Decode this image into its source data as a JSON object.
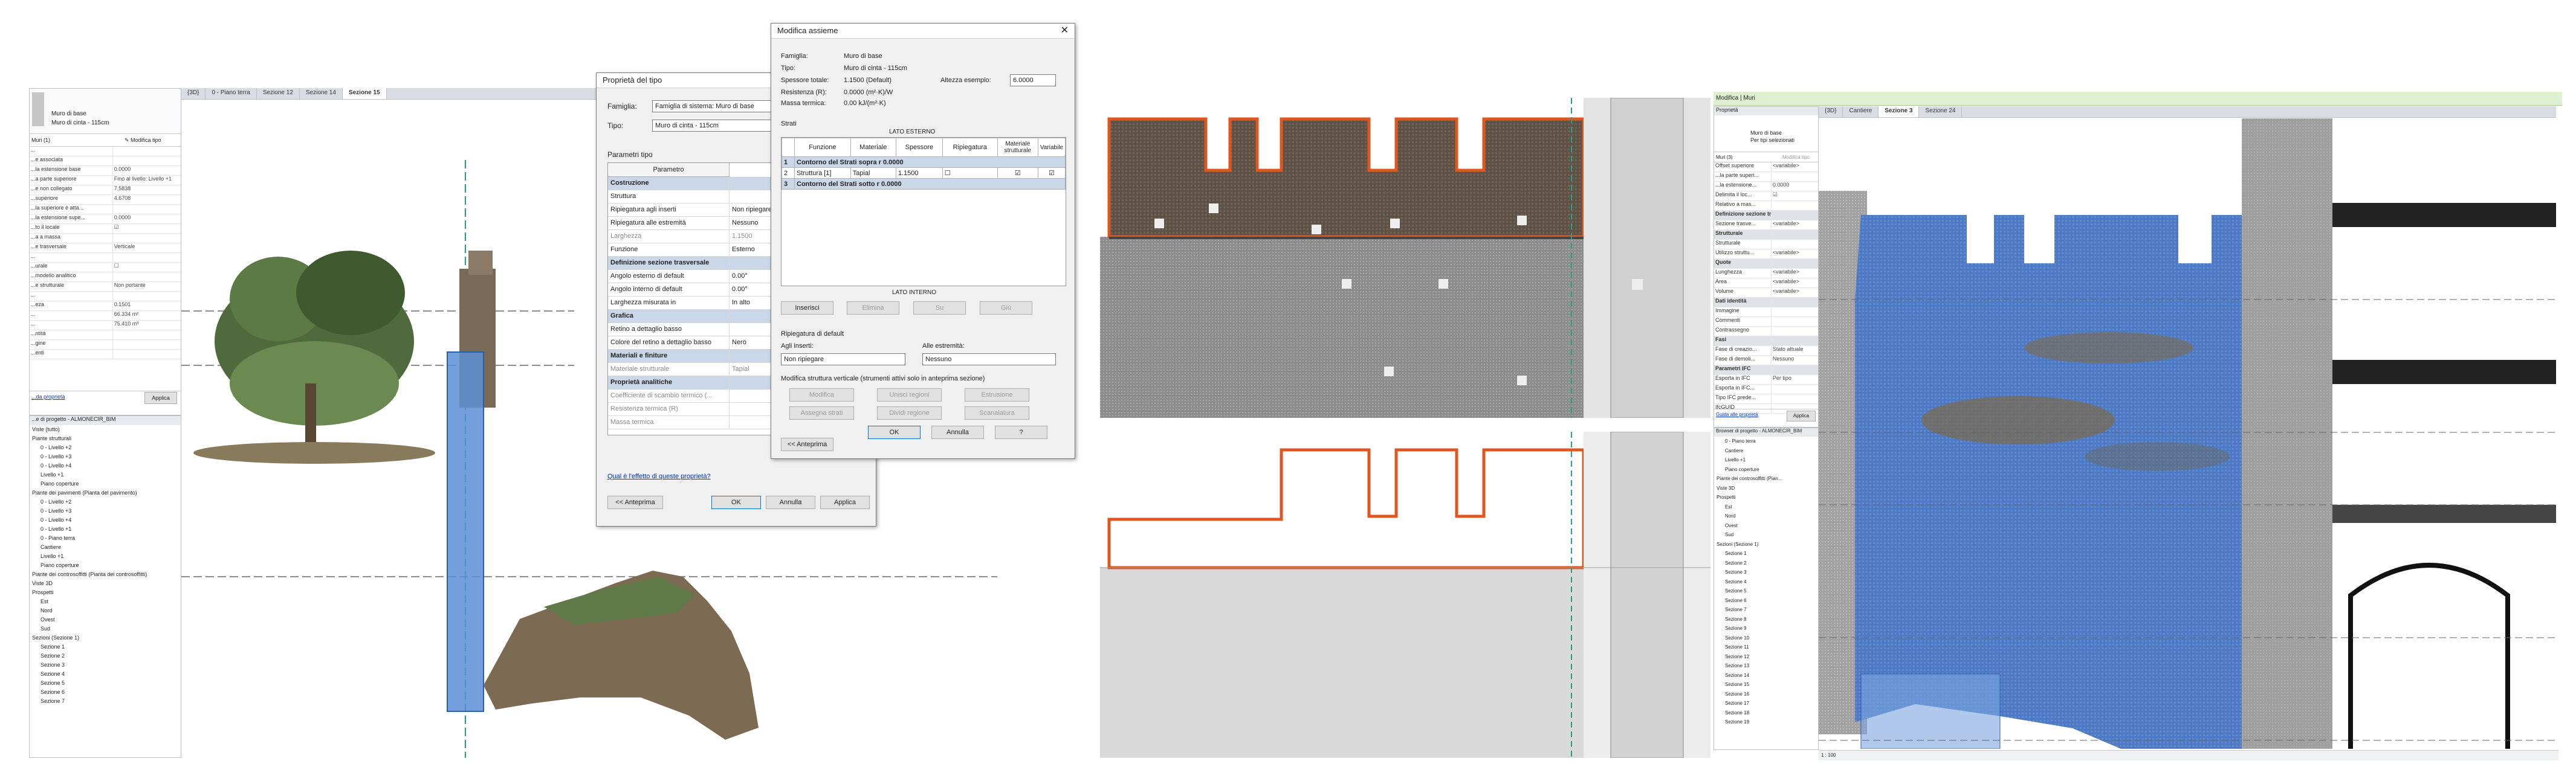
{
  "panel1": {
    "view_tabs": [
      "{3D}",
      "0 - Piano terra",
      "Sezione 12",
      "Sezione 14",
      "Sezione 15"
    ],
    "properties": {
      "type_line1": "Muro di base",
      "type_line2": "Muro di cinta - 115cm",
      "filter_label": "Muri (1)",
      "edit_type_label": "Modifica tipo",
      "rows": [
        {
          "k": "...",
          "v": ""
        },
        {
          "k": "...e associata",
          "v": ""
        },
        {
          "k": "...la estensione base",
          "v": "0.0000"
        },
        {
          "k": "...a parte superiore",
          "v": "Fino al livello: Livello +1"
        },
        {
          "k": "...e non collegato",
          "v": "7.5838"
        },
        {
          "k": "...superiore",
          "v": "4.6708"
        },
        {
          "k": "...la superiore è atta...",
          "v": ""
        },
        {
          "k": "...la estensione supe...",
          "v": "0.0000"
        },
        {
          "k": "...to il locale",
          "v": "☑"
        },
        {
          "k": "...a a massa",
          "v": ""
        },
        {
          "k": "...e trasversale",
          "v": "Verticale"
        },
        {
          "k": "...",
          "v": ""
        },
        {
          "k": "...urale",
          "v": "☐"
        },
        {
          "k": "...modello analitico",
          "v": ""
        },
        {
          "k": "...e strutturale",
          "v": "Non portante"
        },
        {
          "k": "...",
          "v": ""
        },
        {
          "k": "...eza",
          "v": "0.1501"
        },
        {
          "k": "...",
          "v": "66.334 m²"
        },
        {
          "k": "...",
          "v": "75.410 m³"
        },
        {
          "k": "...ntità",
          "v": ""
        },
        {
          "k": "...gine",
          "v": ""
        },
        {
          "k": "...enti",
          "v": ""
        }
      ],
      "help_link": "...da proprietà",
      "apply_label": "Applica"
    },
    "browser_title": "...e di progetto - ALMONECIR_BIM",
    "browser_items": [
      "Viste (tutto)",
      "Piante strutturali",
      "0 - Livello +2",
      "0 - Livello +3",
      "0 - Livello +4",
      "Livello +1",
      "Piano coperture",
      "Piante dei pavimenti (Pianta del pavimento)",
      "0 - Livello +2",
      "0 - Livello +3",
      "0 - Livello +4",
      "0 - Livello +1",
      "0 - Piano terra",
      "Cantiere",
      "Livello +1",
      "Piano coperture",
      "Piante dei controsoffitti (Pianta dei controsoffitti)",
      "Viste 3D",
      "Prospetti",
      "Est",
      "Nord",
      "Ovest",
      "Sud",
      "Sezioni (Sezione 1)",
      "Sezione 1",
      "Sezione 2",
      "Sezione 3",
      "Sezione 4",
      "Sezione 5",
      "Sezione 6",
      "Sezione 7"
    ],
    "dialog": {
      "title": "Proprietà del tipo",
      "family_label": "Famiglia:",
      "family_value": "Famiglia di sistema: Muro di base",
      "type_label": "Tipo:",
      "type_value": "Muro di cinta - 115cm",
      "params_label": "Parametri tipo",
      "col_param": "Parametro",
      "rows": [
        {
          "k": "Costruzione",
          "v": "",
          "cat": true
        },
        {
          "k": "Struttura",
          "v": ""
        },
        {
          "k": "Ripiegatura agli inserti",
          "v": "Non ripiegare"
        },
        {
          "k": "Ripiegatura alle estremità",
          "v": "Nessuno"
        },
        {
          "k": "Larghezza",
          "v": "1.1500",
          "dis": true
        },
        {
          "k": "Funzione",
          "v": "Esterno"
        },
        {
          "k": "Definizione sezione trasversale",
          "v": "",
          "cat": true
        },
        {
          "k": "Angolo esterno di default",
          "v": "0.00°"
        },
        {
          "k": "Angolo interno di default",
          "v": "0.00°"
        },
        {
          "k": "Larghezza misurata in",
          "v": "In alto"
        },
        {
          "k": "Grafica",
          "v": "",
          "cat": true
        },
        {
          "k": "Retino a dettaglio basso",
          "v": ""
        },
        {
          "k": "Colore del retino a dettaglio basso",
          "v": "Nero"
        },
        {
          "k": "Materiali e finiture",
          "v": "",
          "cat": true
        },
        {
          "k": "Materiale strutturale",
          "v": "Tapial",
          "dis": true
        },
        {
          "k": "Proprietà analitiche",
          "v": "",
          "cat": true
        },
        {
          "k": "Coefficiente di scambio termico (...",
          "v": "",
          "dis": true
        },
        {
          "k": "Resistenza termica (R)",
          "v": "",
          "dis": true
        },
        {
          "k": "Massa termica",
          "v": "",
          "dis": true
        }
      ],
      "help_link": "Qual è l'effetto di queste proprietà?",
      "preview_btn": "<< Anteprima",
      "ok_btn": "OK",
      "cancel_btn": "Annulla",
      "apply_btn": "Applica"
    }
  },
  "assembly_dialog": {
    "title": "Modifica assieme",
    "family_label": "Famiglia:",
    "family_value": "Muro di base",
    "type_label": "Tipo:",
    "type_value": "Muro di cinta - 115cm",
    "total_thickness_label": "Spessore totale:",
    "total_thickness_value": "1.1500 (Default)",
    "sample_height_label": "Altezza esempio:",
    "sample_height_value": "6.0000",
    "resistance_label": "Resistenza (R):",
    "resistance_value": "0.0000 (m²·K)/W",
    "thermal_mass_label": "Massa termica:",
    "thermal_mass_value": "0.00 kJ/(m²·K)",
    "layers_label": "Strati",
    "exterior_side": "LATO ESTERNO",
    "interior_side": "LATO INTERNO",
    "columns": [
      "Funzione",
      "Materiale",
      "Spessore",
      "Ripiegatura",
      "Materiale strutturale",
      "Variabile"
    ],
    "layers": [
      {
        "n": "1",
        "func": "Contorno del Strati sopra r 0.0000",
        "mat": "",
        "thick": "",
        "cat": true
      },
      {
        "n": "2",
        "func": "Struttura [1]",
        "mat": "Tapial",
        "thick": "1.1500",
        "cat": false
      },
      {
        "n": "3",
        "func": "Contorno del Strati sotto r 0.0000",
        "mat": "",
        "thick": "",
        "cat": true
      }
    ],
    "buttons": {
      "insert": "Inserisci",
      "delete": "Elimina",
      "up": "Su",
      "down": "Giù"
    },
    "wrap_label": "Ripiegatura di default",
    "at_inserts_label": "Agli inserti:",
    "at_inserts_value": "Non ripiegare",
    "at_ends_label": "Alle estremità:",
    "at_ends_value": "Nessuno",
    "modify_vertical_label": "Modifica struttura verticale (strumenti attivi solo in anteprima sezione)",
    "vert_buttons": [
      "Modifica",
      "Unisci regioni",
      "Estrusione",
      "Assegna strati",
      "Dividi regione",
      "Scanalatura"
    ],
    "preview_btn": "<< Anteprima",
    "ok_btn": "OK",
    "cancel_btn": "Annulla",
    "help_btn": "?"
  },
  "panel4": {
    "ribbon_title": "Modifica | Muri",
    "view_tabs": [
      "{3D}",
      "Cantiere",
      "Sezione 3",
      "Sezione 24"
    ],
    "properties": {
      "header": "Proprietà",
      "type_line1": "Muro di base",
      "type_line2": "Per tipi selezionati",
      "filter_label": "Muri (3)",
      "edit_type_label": "Modifica tipo",
      "rows": [
        {
          "k": "Offset superiore",
          "v": "<variabile>"
        },
        {
          "k": "...la parte superi...",
          "v": ""
        },
        {
          "k": "...la estensione...",
          "v": "0.0000"
        },
        {
          "k": "Delimita il loc...",
          "v": "☑"
        },
        {
          "k": "Relativo a mas...",
          "v": ""
        },
        {
          "k": "Definizione sezione trasversale",
          "v": "",
          "cat": true
        },
        {
          "k": "Sezione trasve...",
          "v": "<variabile>"
        },
        {
          "k": "Strutturale",
          "v": "",
          "cat": true
        },
        {
          "k": "Strutturale",
          "v": ""
        },
        {
          "k": "Utilizzo struttu...",
          "v": "<variabile>"
        },
        {
          "k": "Quote",
          "v": "",
          "cat": true
        },
        {
          "k": "Lunghezza",
          "v": "<variabile>"
        },
        {
          "k": "Area",
          "v": "<variabile>"
        },
        {
          "k": "Volume",
          "v": "<variabile>"
        },
        {
          "k": "Dati identità",
          "v": "",
          "cat": true
        },
        {
          "k": "Immagine",
          "v": ""
        },
        {
          "k": "Commenti",
          "v": ""
        },
        {
          "k": "Contrassegno",
          "v": ""
        },
        {
          "k": "Fasi",
          "v": "",
          "cat": true
        },
        {
          "k": "Fase di creazio...",
          "v": "Stato attuale"
        },
        {
          "k": "Fase di demoli...",
          "v": "Nessuno"
        },
        {
          "k": "Parametri IFC",
          "v": "",
          "cat": true
        },
        {
          "k": "Esporta in IFC",
          "v": "Per tipo"
        },
        {
          "k": "Esporta in IFC...",
          "v": ""
        },
        {
          "k": "Tipo IFC prede...",
          "v": ""
        },
        {
          "k": "IfcGUID",
          "v": ""
        }
      ],
      "help_link": "Guida alle proprietà",
      "apply_label": "Applica"
    },
    "browser_title": "Browser di progetto - ALMONECIR_BIM",
    "browser_items": [
      "0 - Piano terra",
      "Cantiere",
      "Livello +1",
      "Piano coperture",
      "Piante dei controsoffitti (Pian...",
      "Viste 3D",
      "Prospetti",
      "Est",
      "Nord",
      "Ovest",
      "Sud",
      "Sezioni (Sezione 1)",
      "Sezione 1",
      "Sezione 2",
      "Sezione 3",
      "Sezione 4",
      "Sezione 5",
      "Sezione 6",
      "Sezione 7",
      "Sezione 8",
      "Sezione 9",
      "Sezione 10",
      "Sezione 11",
      "Sezione 12",
      "Sezione 13",
      "Sezione 14",
      "Sezione 15",
      "Sezione 16",
      "Sezione 17",
      "Sezione 18",
      "Sezione 19"
    ],
    "scale_label": "1 : 100"
  },
  "colors": {
    "wall_selection": "#5b8fd6",
    "orange_outline": "#e0561f",
    "dialog_bg": "#f0f0f0",
    "category_row": "#c9d7e8"
  }
}
